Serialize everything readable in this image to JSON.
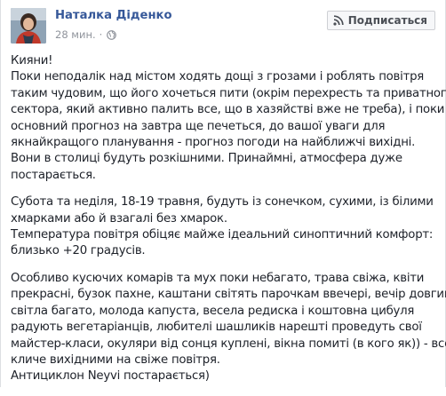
{
  "post": {
    "author": "Наталка Діденко",
    "time": "28 мин.",
    "separator": "·",
    "privacy_icon": "globe-icon",
    "subscribe_label": "Подписаться",
    "subscribe_icon": "rss-icon",
    "paragraphs": [
      {
        "lines": [
          "Кияни!",
          "Поки неподалік над містом ходять дощі з грозами і роблять повітря",
          "таким чудовим, що його хочеться пити (окрім перехресть та приватного",
          "сектора, який активно палить все, що в хазяйстві вже не треба), і поки",
          "основний прогноз на завтра ще печеться, до вашої уваги для",
          "якнайкращого планування - прогноз погоди на найближчі вихідні.",
          "Вони в столиці будуть розкішними. Принаймні, атмосфера дуже",
          "постарається."
        ]
      },
      {
        "lines": [
          "Субота та неділя, 18-19 травня, будуть із сонечком, сухими, із білими",
          "хмарками або й взагалі без хмарок.",
          "Температура повітря обіцяє майже ідеальний синоптичний комфорт:",
          "близько +20 градусів."
        ]
      },
      {
        "lines": [
          "Особливо кусючих комарів та мух поки небагато, трава свіжа, квіти",
          "прекрасні, бузок пахне, каштани світять парочкам ввечері, вечір довгий,",
          "світла багато, молода капуста, весела редиска і коштовна цибуля",
          "радують вегетаріанців, любителі шашликів нарешті проведуть свої",
          "майстер-класи, окуляри від сонця куплені, вікна помиті (в кого як)) - все",
          "кличе вихідними на свіже повітря.",
          "Антициклон Neyvi постарається)"
        ]
      }
    ]
  },
  "colors": {
    "author": "#365899",
    "text": "#1d2129",
    "meta": "#90949c",
    "button_bg": "#f6f7f9",
    "button_border": "#ced0d4"
  }
}
